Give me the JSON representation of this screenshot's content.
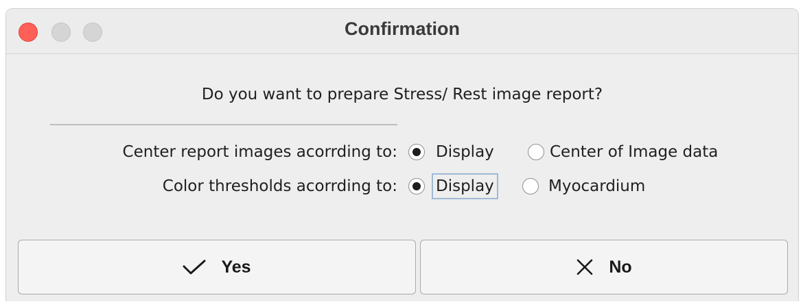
{
  "window": {
    "title": "Confirmation",
    "traffic_lights": {
      "close_color": "#fe5f57",
      "minimize_color": "#d5d5d5",
      "zoom_color": "#d5d5d5"
    }
  },
  "question": "Do you want to prepare Stress/ Rest image report?",
  "options": {
    "center": {
      "label": "Center report images acorrding to:",
      "choices": [
        "Display",
        "Center of Image data"
      ],
      "selected": "Display"
    },
    "color": {
      "label": "Color thresholds acorrding to:",
      "choices": [
        "Display",
        "Myocardium"
      ],
      "selected": "Display",
      "focused": "Display"
    }
  },
  "buttons": {
    "yes": {
      "label": "Yes",
      "icon": "checkmark-icon"
    },
    "no": {
      "label": "No",
      "icon": "close-x-icon"
    }
  }
}
